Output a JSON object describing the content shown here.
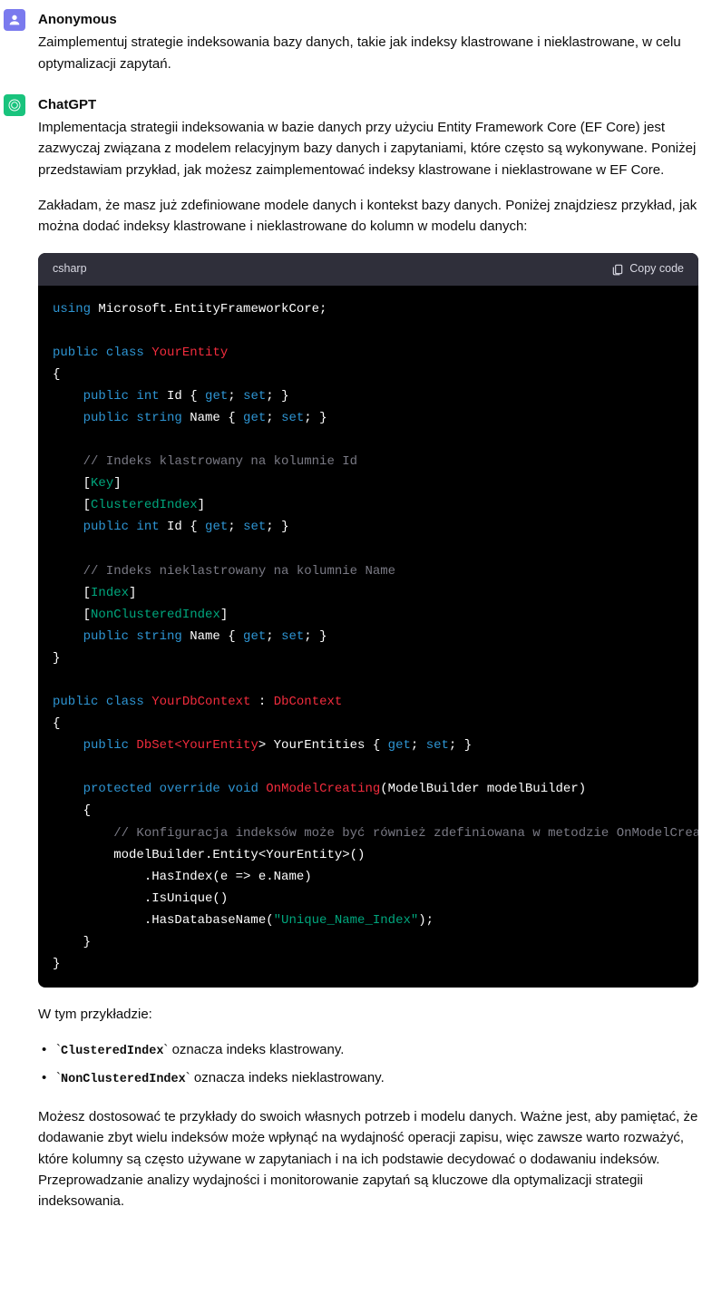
{
  "user": {
    "author": "Anonymous",
    "text": "Zaimplementuj strategie indeksowania bazy danych, takie jak indeksy klastrowane i nieklastrowane, w celu optymalizacji zapytań."
  },
  "assistant": {
    "author": "ChatGPT",
    "intro1": "Implementacja strategii indeksowania w bazie danych przy użyciu Entity Framework Core (EF Core) jest zazwyczaj związana z modelem relacyjnym bazy danych i zapytaniami, które często są wykonywane. Poniżej przedstawiam przykład, jak możesz zaimplementować indeksy klastrowane i nieklastrowane w EF Core.",
    "intro2": "Zakładam, że masz już zdefiniowane modele danych i kontekst bazy danych. Poniżej znajdziesz przykład, jak można dodać indeksy klastrowane i nieklastrowane do kolumn w modelu danych:",
    "after_code": "W tym przykładzie:",
    "bullet1_code": "ClusteredIndex",
    "bullet1_text": " oznacza indeks klastrowany.",
    "bullet2_code": "NonClusteredIndex",
    "bullet2_text": " oznacza indeks nieklastrowany.",
    "outro": "Możesz dostosować te przykłady do swoich własnych potrzeb i modelu danych. Ważne jest, aby pamiętać, że dodawanie zbyt wielu indeksów może wpłynąć na wydajność operacji zapisu, więc zawsze warto rozważyć, które kolumny są często używane w zapytaniach i na ich podstawie decydować o dodawaniu indeksów. Przeprowadzanie analizy wydajności i monitorowanie zapytań są kluczowe dla optymalizacji strategii indeksowania."
  },
  "code_header": {
    "lang": "csharp",
    "copy": "Copy code"
  },
  "code": {
    "l1_a": "using",
    "l1_b": " Microsoft.EntityFrameworkCore;",
    "l3_a": "public",
    "l3_b": " class",
    "l3_c": " YourEntity",
    "l4": "{",
    "l5_a": "    public",
    "l5_b": " int",
    "l5_c": " Id { ",
    "l5_d": "get",
    "l5_e": "; ",
    "l5_f": "set",
    "l5_g": "; }",
    "l6_a": "    public",
    "l6_b": " string",
    "l6_c": " Name { ",
    "l6_d": "get",
    "l6_e": "; ",
    "l6_f": "set",
    "l6_g": "; }",
    "l8": "    // Indeks klastrowany na kolumnie Id",
    "l9_a": "    [",
    "l9_b": "Key",
    "l9_c": "]",
    "l10_a": "    [",
    "l10_b": "ClusteredIndex",
    "l10_c": "]",
    "l11_a": "    public",
    "l11_b": " int",
    "l11_c": " Id { ",
    "l11_d": "get",
    "l11_e": "; ",
    "l11_f": "set",
    "l11_g": "; }",
    "l13": "    // Indeks nieklastrowany na kolumnie Name",
    "l14_a": "    [",
    "l14_b": "Index",
    "l14_c": "]",
    "l15_a": "    [",
    "l15_b": "NonClusteredIndex",
    "l15_c": "]",
    "l16_a": "    public",
    "l16_b": " string",
    "l16_c": " Name { ",
    "l16_d": "get",
    "l16_e": "; ",
    "l16_f": "set",
    "l16_g": "; }",
    "l17": "}",
    "l19_a": "public",
    "l19_b": " class",
    "l19_c": " YourDbContext",
    "l19_d": " : ",
    "l19_e": "DbContext",
    "l20": "{",
    "l21_a": "    public",
    "l21_b": " DbSet<",
    "l21_c": "YourEntity",
    "l21_d": "> YourEntities { ",
    "l21_e": "get",
    "l21_f": "; ",
    "l21_g": "set",
    "l21_h": "; }",
    "l23_a": "    protected",
    "l23_b": " override",
    "l23_c": " void",
    "l23_d": " OnModelCreating",
    "l23_e": "(ModelBuilder modelBuilder)",
    "l24": "    {",
    "l25": "        // Konfiguracja indeksów może być również zdefiniowana w metodzie OnModelCreating",
    "l26": "        modelBuilder.Entity<YourEntity>()",
    "l27": "            .HasIndex(e => e.Name)",
    "l28": "            .IsUnique()",
    "l29_a": "            .HasDatabaseName(",
    "l29_b": "\"Unique_Name_Index\"",
    "l29_c": ");",
    "l30": "    }",
    "l31": "}"
  }
}
